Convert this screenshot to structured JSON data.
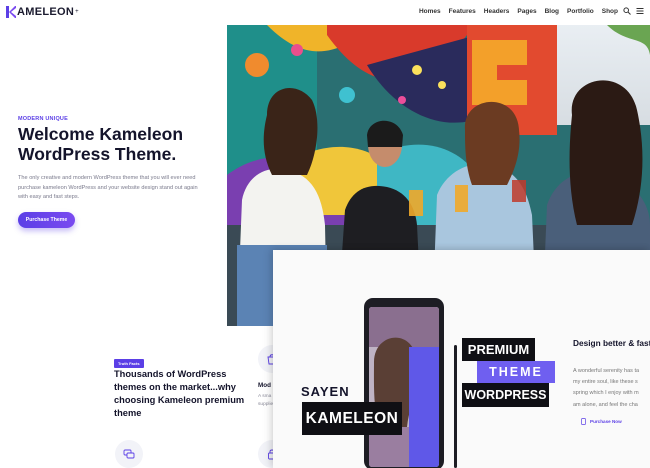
{
  "brand": {
    "name": "AMELEON",
    "sup": "+",
    "accent": "#5b3fe6"
  },
  "nav": {
    "items": [
      "Homes",
      "Features",
      "Headers",
      "Pages",
      "Blog",
      "Portfolio",
      "Shop"
    ]
  },
  "hero": {
    "eyebrow": "MODERN UNIQUE",
    "title": "Welcome Kameleon WordPress Theme.",
    "description": "The only creative and modern WordPress theme that you will ever need purchase kameleon WordPress and your website design stand out again with easy and fast steps.",
    "button": "Purchase Theme"
  },
  "section": {
    "badge": "Truth Facts",
    "heading": "Thousands of WordPress themes on the market...why choosing Kameleon premium theme",
    "feature_title": "Mod",
    "feature_text": "A sma supplie"
  },
  "showcase": {
    "sayen": "SAYEN",
    "kameleon": "KAMELEON",
    "premium": "PREMIUM",
    "theme": "THEME",
    "wordpress": "WORDPRESS",
    "title": "Design better & fasta enjoy the unique use",
    "text": "A wonderful serenity has ta\nmy entire soul, like these s\nspring which I enjoy with m\nam alone, and feel the cha",
    "link": "Purchase Now"
  },
  "icons": [
    "search-icon",
    "menu-icon",
    "bag-icon",
    "chat-icon",
    "lock-icon",
    "phone-icon"
  ]
}
